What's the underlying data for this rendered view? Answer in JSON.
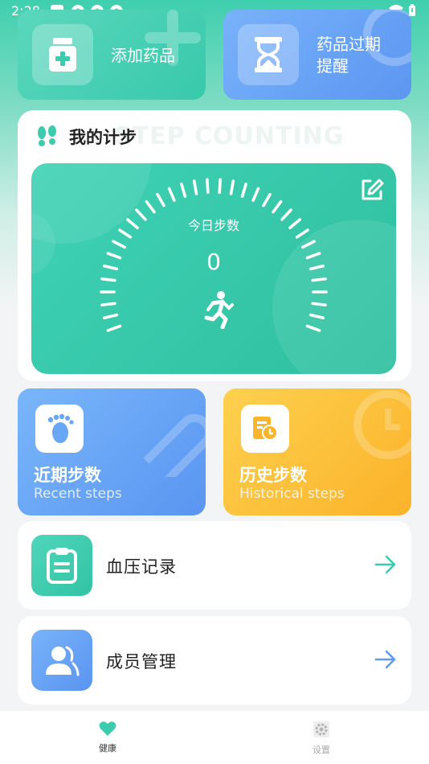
{
  "status_bar": {
    "time": "2:28"
  },
  "top_cards": {
    "add_medicine": "添加药品",
    "expiry_line1": "药品过期",
    "expiry_line2": "提醒"
  },
  "step_card": {
    "title": "我的计步",
    "bg_title": "STEP COUNTING",
    "today_label": "今日步数",
    "today_steps": "0"
  },
  "mid_cards": {
    "recent_zh": "近期步数",
    "recent_en": "Recent steps",
    "history_zh": "历史步数",
    "history_en": "Historical steps"
  },
  "list": {
    "blood_pressure": "血压记录",
    "members": "成员管理"
  },
  "bottom_nav": {
    "health": "健康",
    "settings": "设置"
  },
  "colors": {
    "teal": "#3cccad",
    "blue": "#5f9bf3",
    "orange": "#fcbe33"
  }
}
